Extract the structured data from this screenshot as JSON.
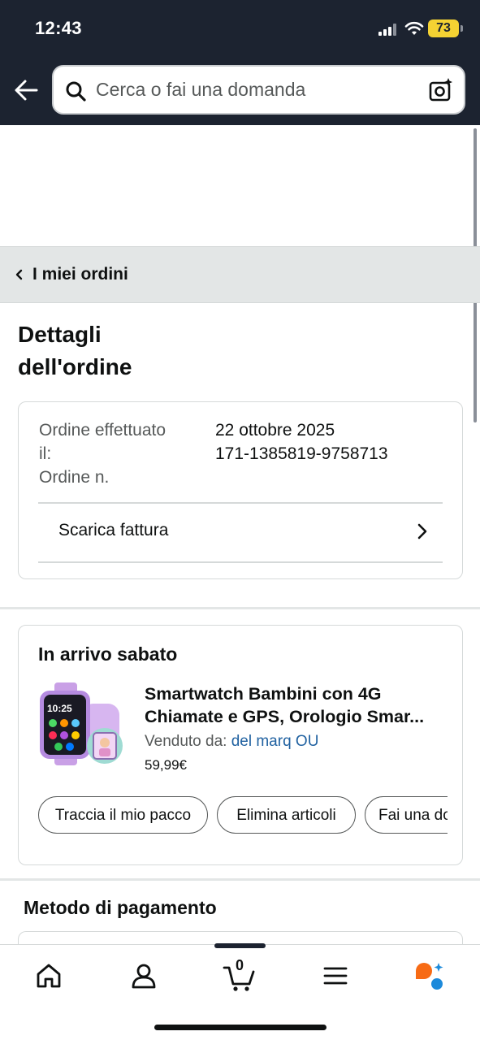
{
  "status_bar": {
    "time": "12:43",
    "battery": "73"
  },
  "search": {
    "placeholder": "Cerca o fai una domanda"
  },
  "breadcrumb": {
    "label": "I miei ordini"
  },
  "page": {
    "title_line1": "Dettagli",
    "title_line2": "dell'ordine"
  },
  "order_info": {
    "placed_label_line1": "Ordine effettuato",
    "placed_label_line2": "il:",
    "order_number_label": "Ordine n.",
    "placed_date": "22 ottobre 2025",
    "order_number": "171-1385819-9758713",
    "invoice_label": "Scarica fattura"
  },
  "shipment": {
    "title": "In arrivo sabato",
    "product_title_line1": "Smartwatch Bambini con 4G",
    "product_title_line2": "Chiamate e GPS, Orologio Smar...",
    "sold_by_label": "Venduto da:",
    "seller": "del marq OU",
    "price": "59,99€",
    "image_time": "10:25",
    "actions": [
      "Traccia il mio pacco",
      "Elimina articoli",
      "Fai una domanda"
    ]
  },
  "payment": {
    "title": "Metodo di pagamento"
  },
  "bottom_nav": {
    "cart_count": "0",
    "items": [
      "home-icon",
      "account-icon",
      "cart-icon",
      "menu-icon",
      "rufus-icon"
    ]
  },
  "colors": {
    "header_bg": "#1c2330",
    "link": "#2162a1",
    "battery": "#f4d233",
    "rufus_orange": "#f76b15",
    "rufus_blue": "#1c8adb"
  }
}
